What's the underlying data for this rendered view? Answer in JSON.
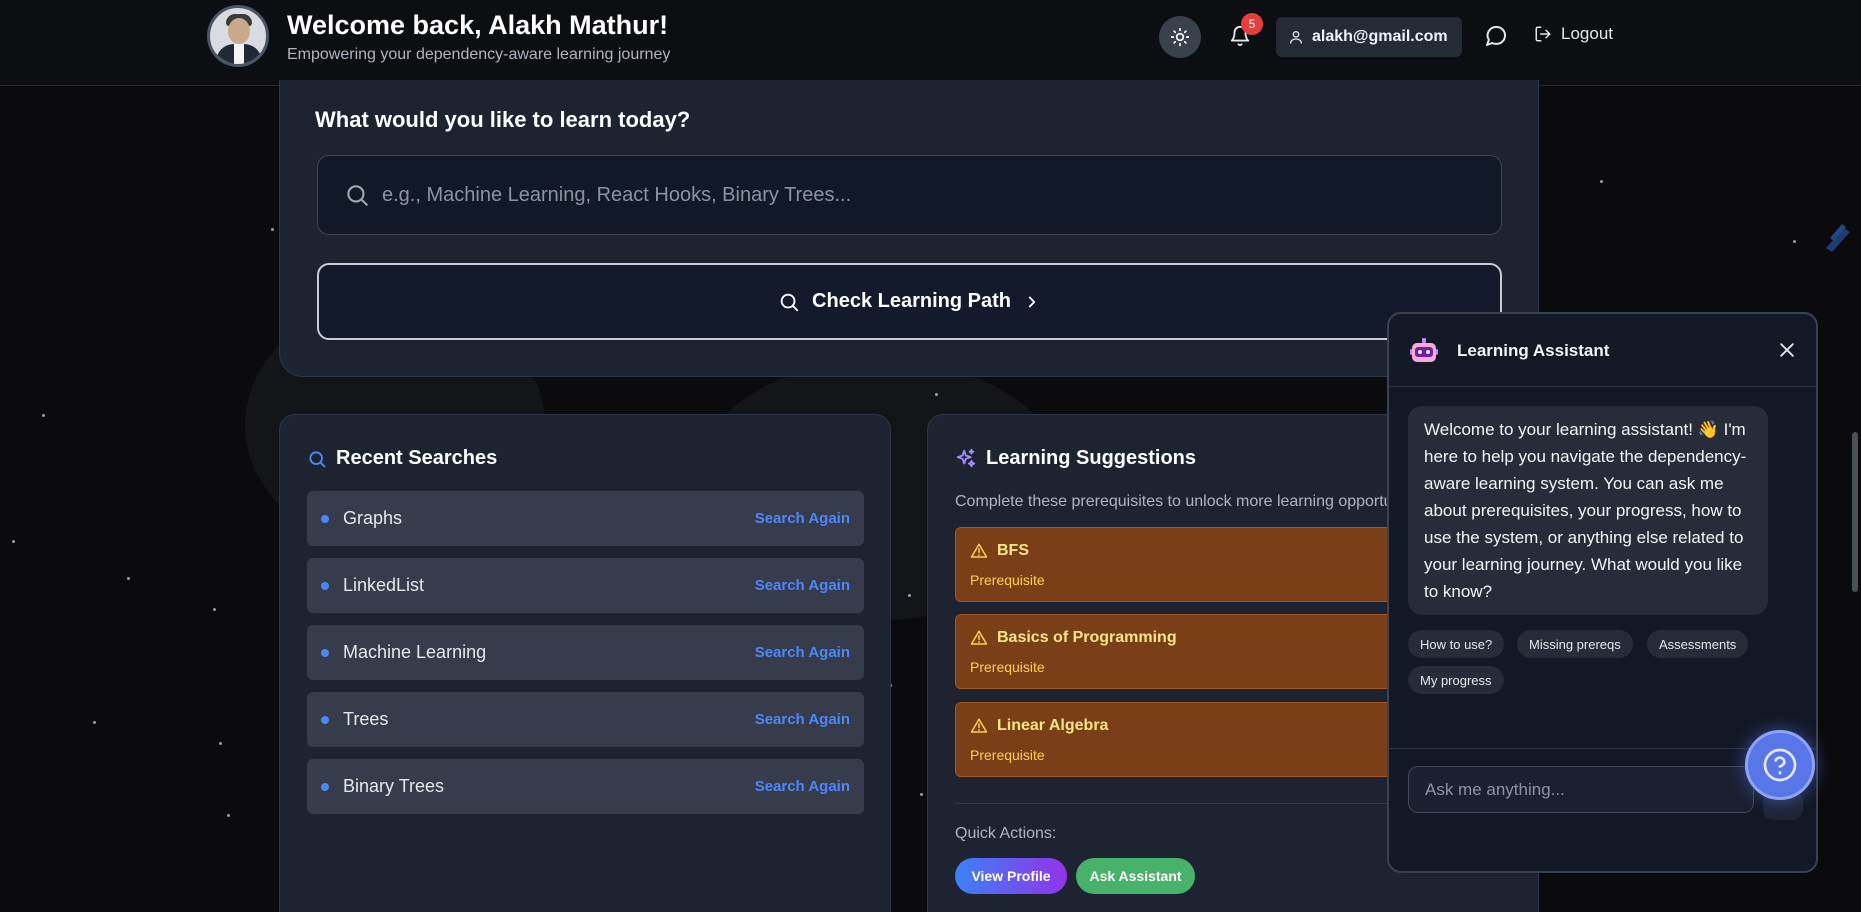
{
  "header": {
    "welcome": "Welcome back, Alakh Mathur!",
    "subtitle": "Empowering your dependency-aware learning journey",
    "notification_count": "5",
    "user_email": "alakh@gmail.com",
    "logout_label": "Logout",
    "icons": {
      "theme": "sun-icon",
      "notifications": "bell-icon",
      "user": "user-icon",
      "chat": "chat-bubble-icon",
      "logout": "logout-icon"
    }
  },
  "search": {
    "title": "What would you like to learn today?",
    "placeholder": "e.g., Machine Learning, React Hooks, Binary Trees...",
    "button_label": "Check Learning Path"
  },
  "recent": {
    "title": "Recent Searches",
    "items": [
      {
        "label": "Graphs",
        "action": "Search Again"
      },
      {
        "label": "LinkedList",
        "action": "Search Again"
      },
      {
        "label": "Machine Learning",
        "action": "Search Again"
      },
      {
        "label": "Trees",
        "action": "Search Again"
      },
      {
        "label": "Binary Trees",
        "action": "Search Again"
      }
    ]
  },
  "suggestions": {
    "title": "Learning Suggestions",
    "description": "Complete these prerequisites to unlock more learning opportu",
    "items": [
      {
        "title": "BFS",
        "tag": "Prerequisite"
      },
      {
        "title": "Basics of Programming",
        "tag": "Prerequisite"
      },
      {
        "title": "Linear Algebra",
        "tag": "Prerequisite"
      }
    ],
    "quick_actions_label": "Quick Actions:",
    "view_profile": "View Profile",
    "ask_assistant": "Ask Assistant"
  },
  "assistant": {
    "title": "Learning Assistant",
    "message": "Welcome to your learning assistant! 👋 I'm here to help you navigate the dependency-aware learning system. You can ask me about prerequisites, your progress, how to use the system, or anything else related to your learning journey. What would you like to know?",
    "chips": [
      "How to use?",
      "Missing prereqs",
      "Assessments",
      "My progress"
    ],
    "input_placeholder": "Ask me anything..."
  },
  "colors": {
    "accent_blue": "#4f86f7",
    "prereq_bg": "#7a3f17",
    "prereq_text": "#fde68a",
    "badge_red": "#e53e3e",
    "assist_green": "#48b26a"
  }
}
